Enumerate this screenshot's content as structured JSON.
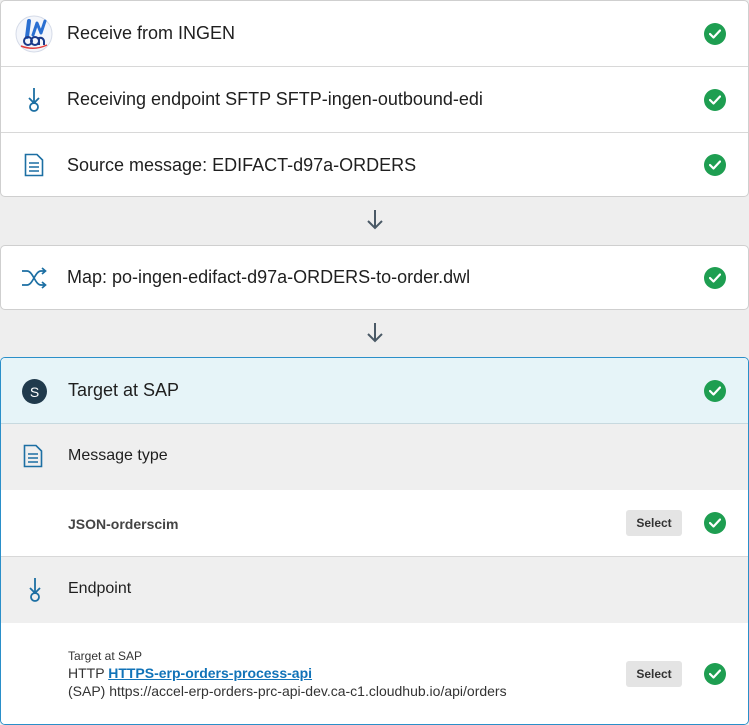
{
  "steps": [
    {
      "label": "Receive from INGEN",
      "icon": "ingen-logo-icon",
      "status": "complete"
    },
    {
      "label": "Receiving endpoint SFTP SFTP-ingen-outbound-edi",
      "icon": "endpoint-icon",
      "status": "complete"
    },
    {
      "label": "Source message: EDIFACT-d97a-ORDERS",
      "icon": "document-icon",
      "status": "complete"
    }
  ],
  "map_step": {
    "label": "Map: po-ingen-edifact-d97a-ORDERS-to-order.dwl",
    "icon": "map-shuffle-icon",
    "status": "complete"
  },
  "target": {
    "avatar_letter": "S",
    "title": "Target at SAP",
    "status": "complete",
    "message_type": {
      "section_label": "Message type",
      "value": "JSON-orderscim",
      "select_label": "Select"
    },
    "endpoint": {
      "section_label": "Endpoint",
      "name": "Target at SAP",
      "protocol": "HTTP",
      "link_text": "HTTPS-erp-orders-process-api",
      "url": "(SAP) https://accel-erp-orders-prc-api-dev.ca-c1.cloudhub.io/api/orders",
      "select_label": "Select"
    }
  },
  "colors": {
    "success": "#1e9e51",
    "accent": "#2a8fc9",
    "icon": "#1c6fa3",
    "link": "#1173b8",
    "selected_bg": "#e6f4f8"
  }
}
